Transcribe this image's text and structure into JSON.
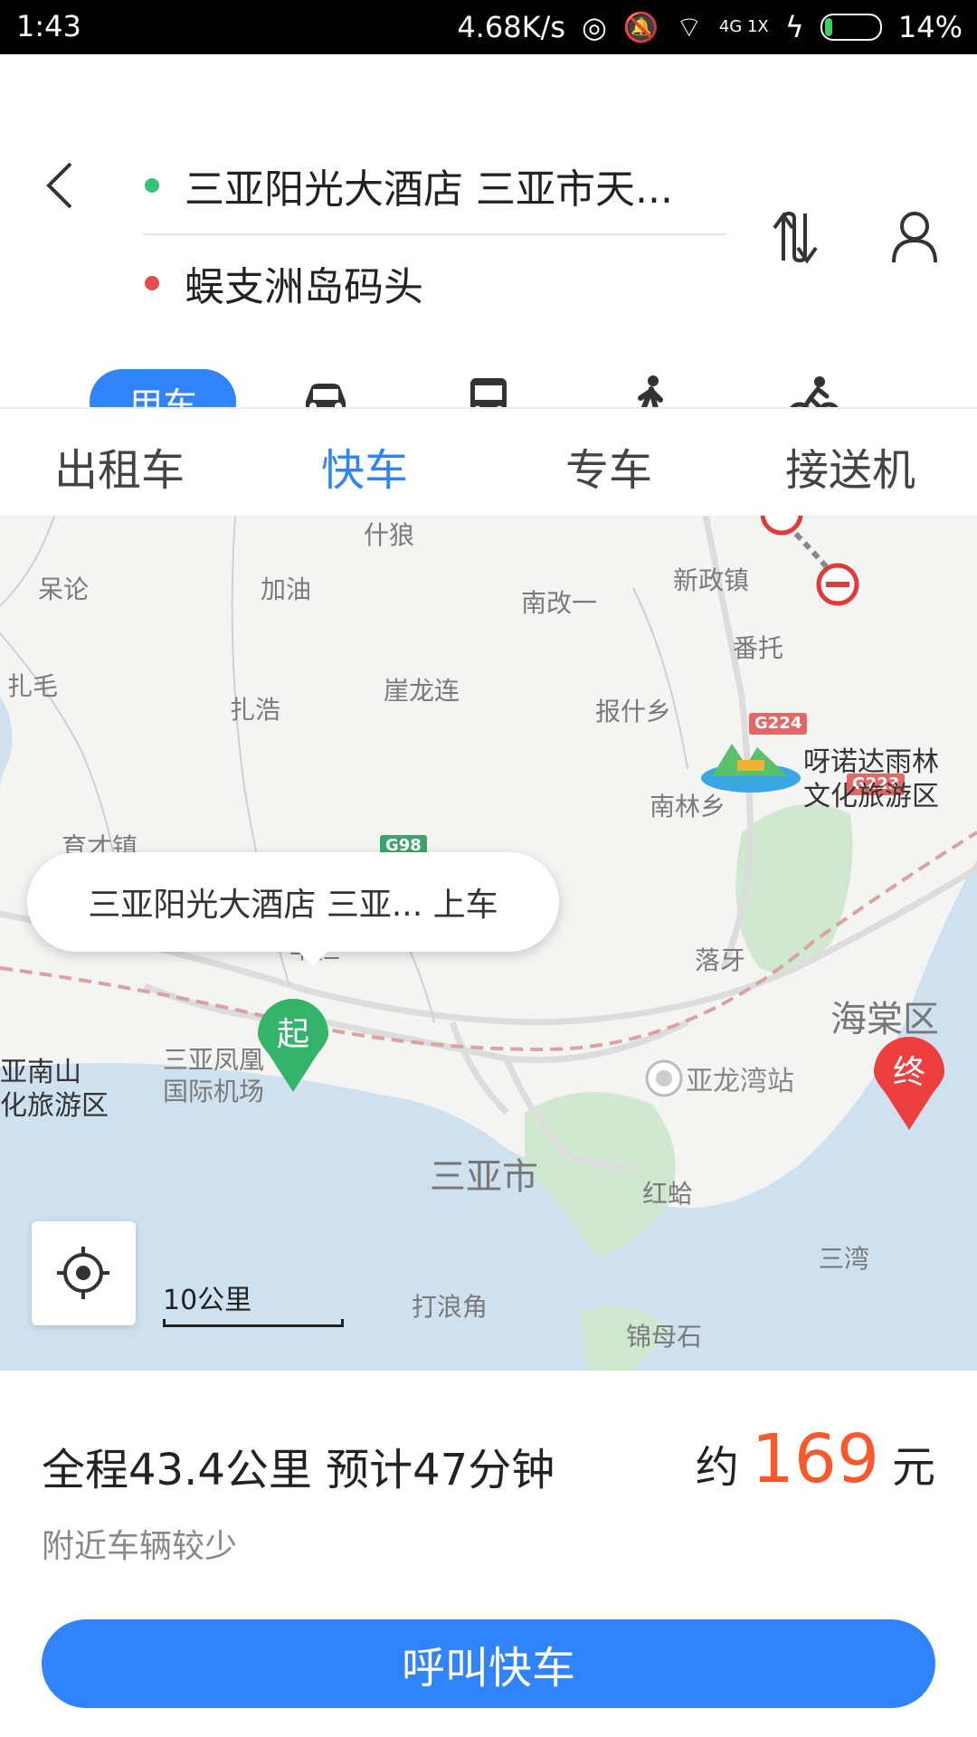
{
  "status_bar": {
    "time": "1:43",
    "speed": "4.68K/s",
    "network": "4G 1X",
    "battery": "14%",
    "battery_level": 0.14
  },
  "route": {
    "origin": "三亚阳光大酒店 三亚市天...",
    "destination": "蜈支洲岛码头",
    "origin_color": "#33c27a",
    "destination_color": "#e84b4b"
  },
  "modes": {
    "active_label": "用车",
    "items": [
      "car-icon",
      "bus-icon",
      "walk-icon",
      "bike-icon"
    ]
  },
  "tabs": [
    {
      "label": "出租车"
    },
    {
      "label": "快车",
      "active": true
    },
    {
      "label": "专车"
    },
    {
      "label": "接送机"
    }
  ],
  "map": {
    "callout": "三亚阳光大酒店 三亚... 上车",
    "start_pin": "起",
    "end_pin": "终",
    "scale": "10公里",
    "labels": {
      "shilang": "什狼",
      "chenglun": "呆论",
      "jiayou": "加油",
      "nangaiyi": "南改一",
      "xinzhengzhen": "新政镇",
      "fantuo": "番托",
      "zhamao": "扎毛",
      "zhahao": "扎浩",
      "yalonglian": "崖龙连",
      "baoshixiang": "报什乡",
      "yunuoda": "呀诺达雨林",
      "yunuoda2": "文化旅游区",
      "yucaizhen": "育才镇",
      "nanlinxiang": "南林乡",
      "yanglan": "羊栏",
      "luoya": "落牙",
      "haitangqu": "海棠区",
      "nanshan": "亚南山",
      "nanshan2": "化旅游区",
      "airport1": "三亚凤凰",
      "airport2": "国际机场",
      "yalongwan": "亚龙湾站",
      "sanyashi": "三亚市",
      "honggeng": "红蛤",
      "sanwan": "三湾",
      "dalangjiao": "打浪角",
      "jinmushi": "锦母石"
    },
    "roads": {
      "g224": "G224",
      "g223": "G223",
      "g98": "G98"
    },
    "colors": {
      "sea": "#cfe0ef",
      "park": "#cfe8cf",
      "road": "#e0e0e0"
    }
  },
  "summary": {
    "trip": "全程43.4公里 预计47分钟",
    "price_prefix": "约",
    "price": "169",
    "price_suffix": "元",
    "hint": "附近车辆较少"
  },
  "call_button": "呼叫快车",
  "accent": "#3083f8"
}
